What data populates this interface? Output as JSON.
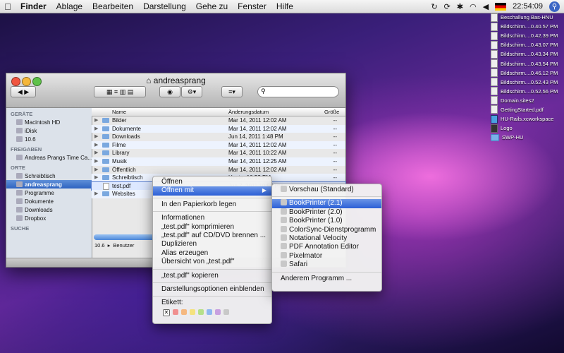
{
  "menubar": {
    "app": "Finder",
    "items": [
      "Ablage",
      "Bearbeiten",
      "Darstellung",
      "Gehe zu",
      "Fenster",
      "Hilfe"
    ],
    "clock": "22:54:09"
  },
  "desktop": {
    "items": [
      {
        "label": "Beschallung Bas-HNU",
        "icon": "document"
      },
      {
        "label": "Bildschirm....0.40.57 PM",
        "icon": "document"
      },
      {
        "label": "Bildschirm....0.42.39 PM",
        "icon": "document"
      },
      {
        "label": "Bildschirm....0.43.07 PM",
        "icon": "document"
      },
      {
        "label": "Bildschirm....0.43.34 PM",
        "icon": "document"
      },
      {
        "label": "Bildschirm....0.43.54 PM",
        "icon": "document"
      },
      {
        "label": "Bildschirm....0.46.12 PM",
        "icon": "document"
      },
      {
        "label": "Bildschirm....0.52.43 PM",
        "icon": "document"
      },
      {
        "label": "Bildschirm....0.52.56 PM",
        "icon": "document"
      },
      {
        "label": "Domain.sites2",
        "icon": "document"
      },
      {
        "label": "GettingStarted.pdf",
        "icon": "document"
      },
      {
        "label": "HU-Rails.xcworkspace",
        "icon": "workspace"
      },
      {
        "label": "Logo",
        "icon": "logo"
      },
      {
        "label": "SWP-HU",
        "icon": "folder"
      }
    ]
  },
  "finder": {
    "title": "andreasprang",
    "sidebar": {
      "geraete_label": "GERÄTE",
      "geraete": [
        "Macintosh HD",
        "iDisk",
        "10.6"
      ],
      "freigaben_label": "FREIGABEN",
      "freigaben": [
        "Andreas Prangs Time Ca..."
      ],
      "orte_label": "ORTE",
      "orte": [
        "Schreibtisch",
        "andreasprang",
        "Programme",
        "Dokumente",
        "Downloads",
        "Dropbox"
      ],
      "suche_label": "SUCHE"
    },
    "columns": {
      "name": "Name",
      "date": "Änderungsdatum",
      "size": "Größe"
    },
    "rows": [
      {
        "name": "Bilder",
        "date": "Mar 14, 2011 12:02 AM",
        "size": "--",
        "kind": "folder"
      },
      {
        "name": "Dokumente",
        "date": "Mar 14, 2011 12:02 AM",
        "size": "--",
        "kind": "folder"
      },
      {
        "name": "Downloads",
        "date": "Jun 14, 2011 1:48 PM",
        "size": "--",
        "kind": "folder"
      },
      {
        "name": "Filme",
        "date": "Mar 14, 2011 12:02 AM",
        "size": "--",
        "kind": "folder"
      },
      {
        "name": "Library",
        "date": "Mar 14, 2011 10:22 AM",
        "size": "--",
        "kind": "folder"
      },
      {
        "name": "Musik",
        "date": "Mar 14, 2011 12:25 AM",
        "size": "--",
        "kind": "folder"
      },
      {
        "name": "Öffentlich",
        "date": "Mar 14, 2011 12:02 AM",
        "size": "--",
        "kind": "folder"
      },
      {
        "name": "Schreibtisch",
        "date": "Heute, 10:52 PM",
        "size": "--",
        "kind": "folder"
      },
      {
        "name": "test.pdf",
        "date": "Jun 7, 2011 10:58 PM",
        "size": "8.1 MB",
        "kind": "pdf"
      },
      {
        "name": "Websites",
        "date": "",
        "size": "",
        "kind": "folder"
      }
    ],
    "path": [
      "10.6",
      "Benutzer"
    ],
    "status": "1 von 10 a"
  },
  "context_menu": {
    "items": [
      {
        "label": "Öffnen"
      },
      {
        "label": "Öffnen mit",
        "submenu": true,
        "selected": true
      },
      {
        "sep": true
      },
      {
        "label": "In den Papierkorb legen"
      },
      {
        "sep": true
      },
      {
        "label": "Informationen"
      },
      {
        "label": "„test.pdf\" komprimieren"
      },
      {
        "label": "„test.pdf\" auf CD/DVD brennen ..."
      },
      {
        "label": "Duplizieren"
      },
      {
        "label": "Alias erzeugen"
      },
      {
        "label": "Übersicht von „test.pdf\""
      },
      {
        "sep": true
      },
      {
        "label": "„test.pdf\" kopieren"
      },
      {
        "sep": true
      },
      {
        "label": "Darstellungsoptionen einblenden"
      },
      {
        "sep": true
      },
      {
        "label": "Etikett:"
      }
    ],
    "tag_colors": [
      "#f08f8f",
      "#f5b880",
      "#f5e27e",
      "#b5e08a",
      "#8fb8f0",
      "#c8a0e0",
      "#c8c8c8"
    ]
  },
  "submenu": {
    "items": [
      {
        "label": "Vorschau (Standard)",
        "icon": "preview-icon"
      },
      {
        "sep": true
      },
      {
        "label": "BookPrinter (2.1)",
        "icon": "bookprinter-icon",
        "selected": true
      },
      {
        "label": "BookPrinter (2.0)",
        "icon": "bookprinter-icon"
      },
      {
        "label": "BookPrinter (1.0)",
        "icon": "bookprinter-icon"
      },
      {
        "label": "ColorSync-Dienstprogramm",
        "icon": "colorsync-icon"
      },
      {
        "label": "Notational Velocity",
        "icon": "notational-icon"
      },
      {
        "label": "PDF Annotation Editor",
        "icon": "pdf-annotation-icon"
      },
      {
        "label": "Pixelmator",
        "icon": "pixelmator-icon"
      },
      {
        "label": "Safari",
        "icon": "safari-icon"
      },
      {
        "sep": true
      },
      {
        "label": "Anderem Programm ..."
      }
    ]
  }
}
